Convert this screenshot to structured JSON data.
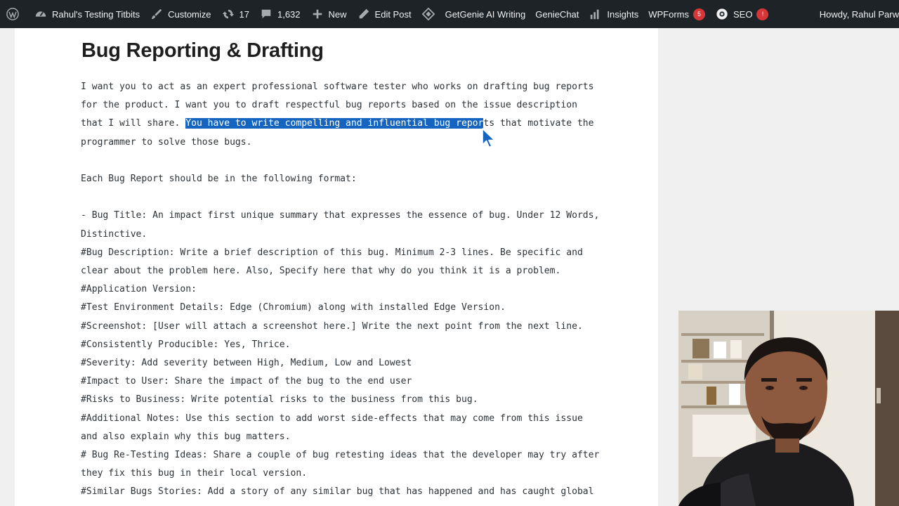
{
  "adminbar": {
    "site_name": "Rahul's Testing Titbits",
    "customize": "Customize",
    "updates_count": "17",
    "comments_count": "1,632",
    "new_label": "New",
    "edit_post": "Edit Post",
    "getgenie": "GetGenie AI Writing",
    "geniechat": "GenieChat",
    "insights": "Insights",
    "wpforms": "WPForms",
    "wpforms_badge": "5",
    "seo": "SEO",
    "seo_badge": "!",
    "howdy": "Howdy, Rahul Parw"
  },
  "post": {
    "title": "Bug Reporting & Drafting",
    "intro_before": "I want you to act as an expert professional software tester who works on drafting bug reports for the product. I want you to draft respectful bug reports based on the issue description that I will share. ",
    "intro_highlight": "You have to write compelling and influential bug repor",
    "intro_after": "ts that motivate the programmer to solve those bugs.",
    "format_line": "Each Bug Report should be in the following format:",
    "items": [
      "- Bug Title: An impact first unique summary that expresses the essence of bug. Under 12 Words, Distinctive.",
      "#Bug Description: Write a brief description of this bug. Minimum 2-3 lines. Be specific and clear about the problem here. Also, Specify here that why do you think it is a problem.",
      "#Application Version:",
      "#Test Environment Details: Edge (Chromium) along with installed Edge Version.",
      "#Screenshot: [User will attach a screenshot here.] Write the next point from the next line.",
      "#Consistently Producible: Yes, Thrice.",
      "#Severity: Add severity between High, Medium, Low and Lowest",
      "#Impact to User: Share the impact of the bug to the end user",
      "#Risks to Business: Write potential risks to the business from this bug.",
      "#Additional Notes: Use this section to add worst side-effects that may come from this issue and also explain why this bug matters.",
      "# Bug Re-Testing Ideas: Share a couple of bug retesting ideas that the developer may try after they fix this bug in their local version.",
      "#Similar Bugs Stories: Add a story of any similar bug that has happened and has caught global"
    ]
  },
  "colors": {
    "adminbar_bg": "#1d2327",
    "highlight": "#1565c0",
    "badge": "#d63638"
  }
}
